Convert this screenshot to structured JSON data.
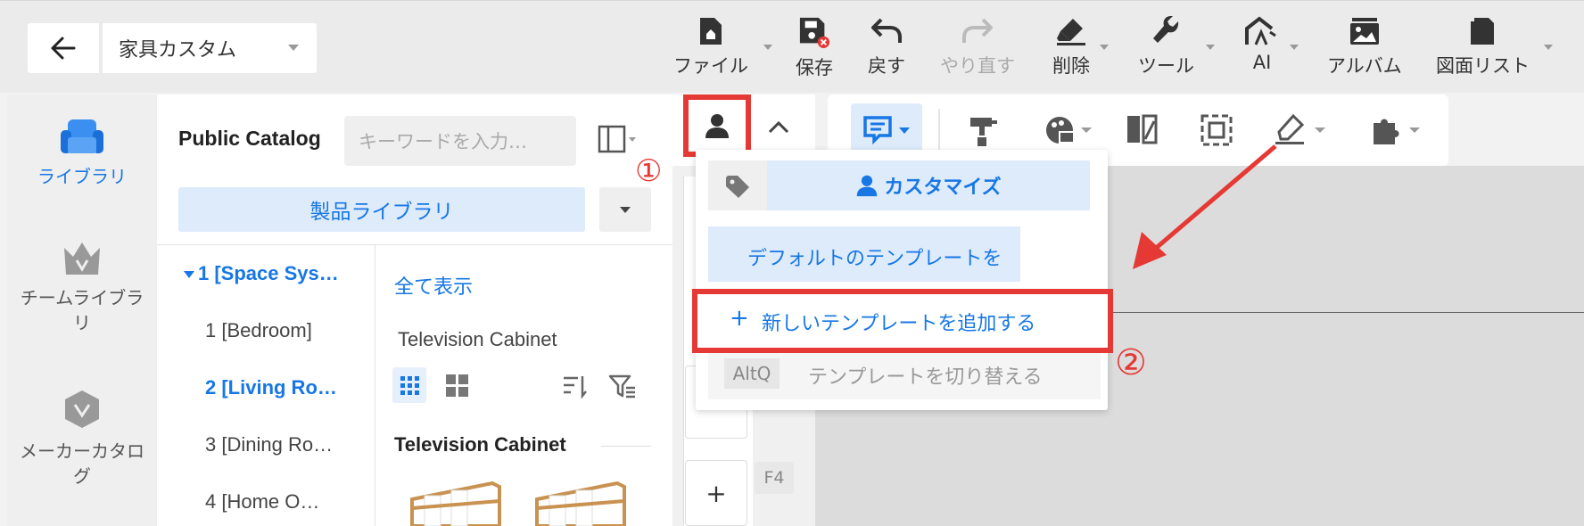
{
  "header": {
    "project_name": "家具カスタム",
    "toolbar": [
      {
        "label": "ファイル",
        "icon": "file-icon"
      },
      {
        "label": "保存",
        "icon": "save-icon"
      },
      {
        "label": "戻す",
        "icon": "undo-icon"
      },
      {
        "label": "やり直す",
        "icon": "redo-icon"
      },
      {
        "label": "削除",
        "icon": "eraser-icon"
      },
      {
        "label": "ツール",
        "icon": "wrench-icon"
      },
      {
        "label": "AI",
        "icon": "ai-icon"
      },
      {
        "label": "アルバム",
        "icon": "album-icon"
      },
      {
        "label": "図面リスト",
        "icon": "drawing-list-icon"
      }
    ]
  },
  "nav": {
    "items": [
      {
        "label": "ライブラリ",
        "icon": "sofa-icon"
      },
      {
        "label": "チームライブラリ",
        "icon": "crown-icon"
      },
      {
        "label": "メーカーカタログ",
        "icon": "badge-icon"
      }
    ]
  },
  "catalog": {
    "title": "Public Catalog",
    "search_placeholder": "キーワードを入力…",
    "library_label": "製品ライブラリ",
    "tree": [
      "1 [Space Sys…",
      "1 [Bedroom]",
      "2 [Living Ro…",
      "3 [Dining Ro…",
      "4 [Home O…"
    ],
    "show_all": "全て表示",
    "breadcrumb": "Television Cabinet",
    "section_title": "Television Cabinet"
  },
  "strip": {
    "shortcut": "F4"
  },
  "dropdown": {
    "tab_label": "カスタマイズ",
    "default_template": "デフォルトのテンプレートを",
    "add_template": "新しいテンプレートを追加する",
    "add_symbol": "+",
    "switch_shortcut": "AltQ",
    "switch_template": "テンプレートを切り替える"
  },
  "annotations": {
    "step1": "①",
    "step2": "②",
    "color": "#e53935"
  },
  "colors": {
    "accent": "#1677e5",
    "highlight": "#e53935"
  }
}
